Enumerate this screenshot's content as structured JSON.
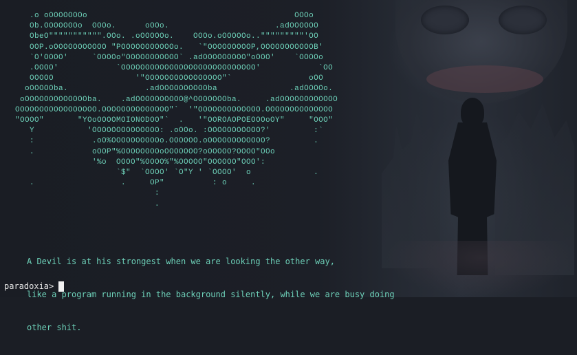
{
  "terminal": {
    "ascii_art_lines": [
      "      .o oOOOOOOOo                                           OOOo",
      "      Ob.OOOOOOOo  OOOo.      oOOo.                      .adOOOOOO",
      "      ObeO\"\"\"\"\"\"\"\"\"\"\".OOo. .oOOOOOo.    OOOo.oOOOOOo..\"\"\"\"\"\"\"\"\"'OO",
      "      OOP.oOOOOOOOOOOO \"POOOOOOOOOOOo.   `\"OOOOOOOOOP,OOOOOOOOOOOB'",
      "      `O'OOOO'     `OOOOo\"OOOOOOOOOOO` .adOOOOOOOOO\"oOOO'    `OOOOo",
      "      .OOOO'            `OOOOOOOOOOOOOOOOOOOOOOOOOOOO'            `OO",
      "      OOOOO                 '\"OOOOOOOOOOOOOOOO\"`                oOO",
      "     oOOOOOba.                .adOOOOOOOOOOba               .adOOOOo.",
      "    oOOOOOOOOOOOOOba.    .adOOOOOOOOOO@^OOOOOOOba.     .adOOOOOOOOOOOO",
      "   OOOOOOOOOOOOOOOOO.OOOOOOOOOOOOOO\"`  '\"OOOOOOOOOOOOO.OOOOOOOOOOOOOO",
      "   \"OOOO\"       \"YOoOOOOMOIONODOO\"`  .   '\"OOROAOPOEOOOoOY\"     \"OOO\"",
      "      Y           'OOOOOOOOOOOOOO: .oOOo. :OOOOOOOOOOO?'         :`",
      "      :            .oO%OOOOOOOOOOo.OOOOOO.oOOOOOOOOOOOO?         .",
      "      .            oOOP\"%OOOOOOOOoOOOOOOO?oOOOOO?OOOO\"OOo",
      "                   '%o  OOOO\"%OOOO%\"%OOOOO\"OOOOOO\"OOO':",
      "                        `$\"  `OOOO' `O\"Y ' `OOOO'  o             .",
      "      .                  .     OP\"          : o     .",
      "                                :",
      "                                ."
    ],
    "quote_lines": [
      "A Devil is at his strongest when we are looking the other way,",
      "like a program running in the background silently, while we are busy doing",
      "other shit."
    ],
    "prompt": "paradoxia>"
  }
}
